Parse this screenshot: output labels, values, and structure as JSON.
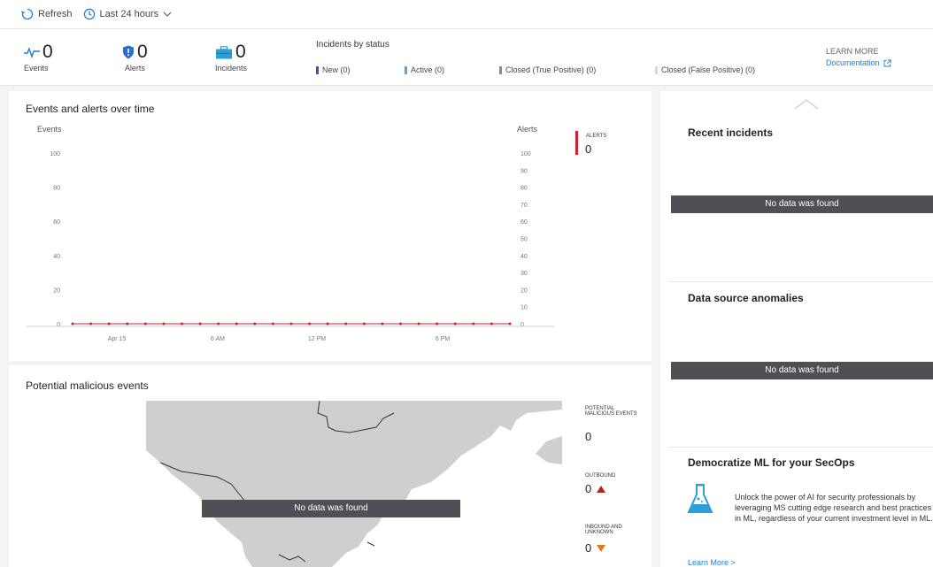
{
  "toolbar": {
    "refresh_label": "Refresh",
    "timerange_label": "Last 24 hours"
  },
  "summary": {
    "events": {
      "value": "0",
      "label": "Events"
    },
    "alerts": {
      "value": "0",
      "label": "Alerts"
    },
    "incidents": {
      "value": "0",
      "label": "Incidents"
    },
    "incidents_by_status": {
      "title": "Incidents by status",
      "items": [
        {
          "label": "New (0)",
          "color": "#1f5fb0"
        },
        {
          "label": "Active (0)",
          "color": "#5aa4e6"
        },
        {
          "label": "Closed (True Positive) (0)",
          "color": "#8a8a8a"
        },
        {
          "label": "Closed (False Positive) (0)",
          "color": "#d7d7d7"
        }
      ]
    },
    "learn_more": "LEARN MORE",
    "documentation": "Documentation"
  },
  "events_chart": {
    "title": "Events and alerts over time",
    "left_axis_label": "Events",
    "right_axis_label": "Alerts",
    "legend_label": "ALERTS",
    "legend_value": "0"
  },
  "chart_data": {
    "type": "line",
    "title": "Events and alerts over time",
    "x_ticks": [
      "Apr 15",
      "6 AM",
      "12 PM",
      "6 PM"
    ],
    "left_axis": {
      "label": "Events",
      "ticks": [
        0,
        20,
        40,
        60,
        80,
        100
      ],
      "ylim": [
        0,
        100
      ]
    },
    "right_axis": {
      "label": "Alerts",
      "ticks": [
        0,
        10,
        20,
        30,
        40,
        50,
        60,
        70,
        80,
        90,
        100
      ],
      "ylim": [
        0,
        100
      ]
    },
    "series": [
      {
        "name": "ALERTS",
        "color": "#d02030",
        "values": [
          0,
          0,
          0,
          0,
          0,
          0,
          0,
          0,
          0,
          0,
          0,
          0,
          0,
          0,
          0,
          0,
          0,
          0,
          0,
          0,
          0,
          0,
          0,
          0,
          0
        ]
      }
    ]
  },
  "malicious": {
    "title": "Potential malicious events",
    "no_data": "No data was found",
    "stats": [
      {
        "label": "POTENTIAL MALICIOUS EVENTS",
        "value": "0",
        "indicator": ""
      },
      {
        "label": "OUTBOUND",
        "value": "0",
        "indicator": "up",
        "color": "#b22222"
      },
      {
        "label": "INBOUND AND UNKNOWN",
        "value": "0",
        "indicator": "down",
        "color": "#e07b1a"
      }
    ]
  },
  "right": {
    "recent_incidents": {
      "title": "Recent incidents",
      "no_data": "No data was found"
    },
    "anomalies": {
      "title": "Data source anomalies",
      "no_data": "No data was found"
    },
    "ml": {
      "title": "Democratize ML for your SecOps",
      "text": "Unlock the power of AI for security professionals by leveraging MS cutting edge research and best practices in ML, regardless of your current investment level in ML.",
      "link": "Learn More >"
    }
  }
}
